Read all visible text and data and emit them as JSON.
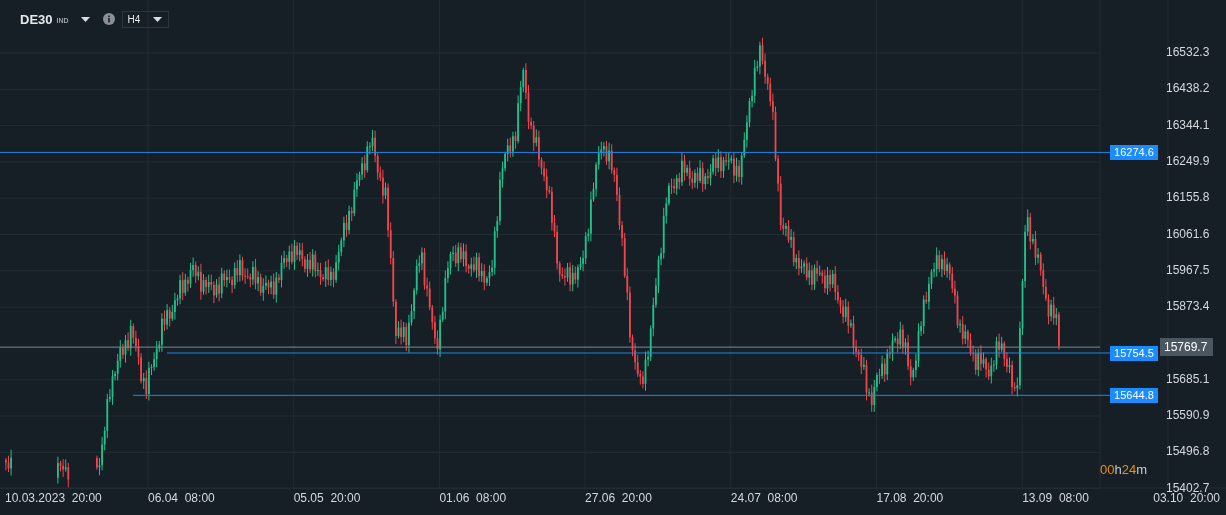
{
  "header": {
    "symbol": "DE30",
    "symbol_type": "IND",
    "timeframe": "H4"
  },
  "price_axis": {
    "ticks": [
      "16532.3",
      "16438.2",
      "16344.1",
      "16249.9",
      "16155.8",
      "16061.6",
      "15967.5",
      "15873.4",
      "15685.1",
      "15590.9",
      "15496.8",
      "15402.7"
    ]
  },
  "time_axis": [
    {
      "date": "10.03.2023",
      "time": "20:00"
    },
    {
      "date": "06.04",
      "time": "08:00"
    },
    {
      "date": "05.05",
      "time": "20:00"
    },
    {
      "date": "01.06",
      "time": "08:00"
    },
    {
      "date": "27.06",
      "time": "20:00"
    },
    {
      "date": "24.07",
      "time": "08:00"
    },
    {
      "date": "17.08",
      "time": "20:00"
    },
    {
      "date": "13.09",
      "time": "08:00"
    },
    {
      "date": "03.10",
      "time": "20:00"
    }
  ],
  "levels": [
    {
      "price": "16274.6"
    },
    {
      "price": "15754.5"
    },
    {
      "price": "15644.8"
    }
  ],
  "current_price": "15769.7",
  "countdown": [
    {
      "text": "00",
      "kind": "value"
    },
    {
      "text": "h",
      "kind": "unit"
    },
    {
      "text": "24",
      "kind": "value"
    },
    {
      "text": "m",
      "kind": "unit"
    }
  ]
}
